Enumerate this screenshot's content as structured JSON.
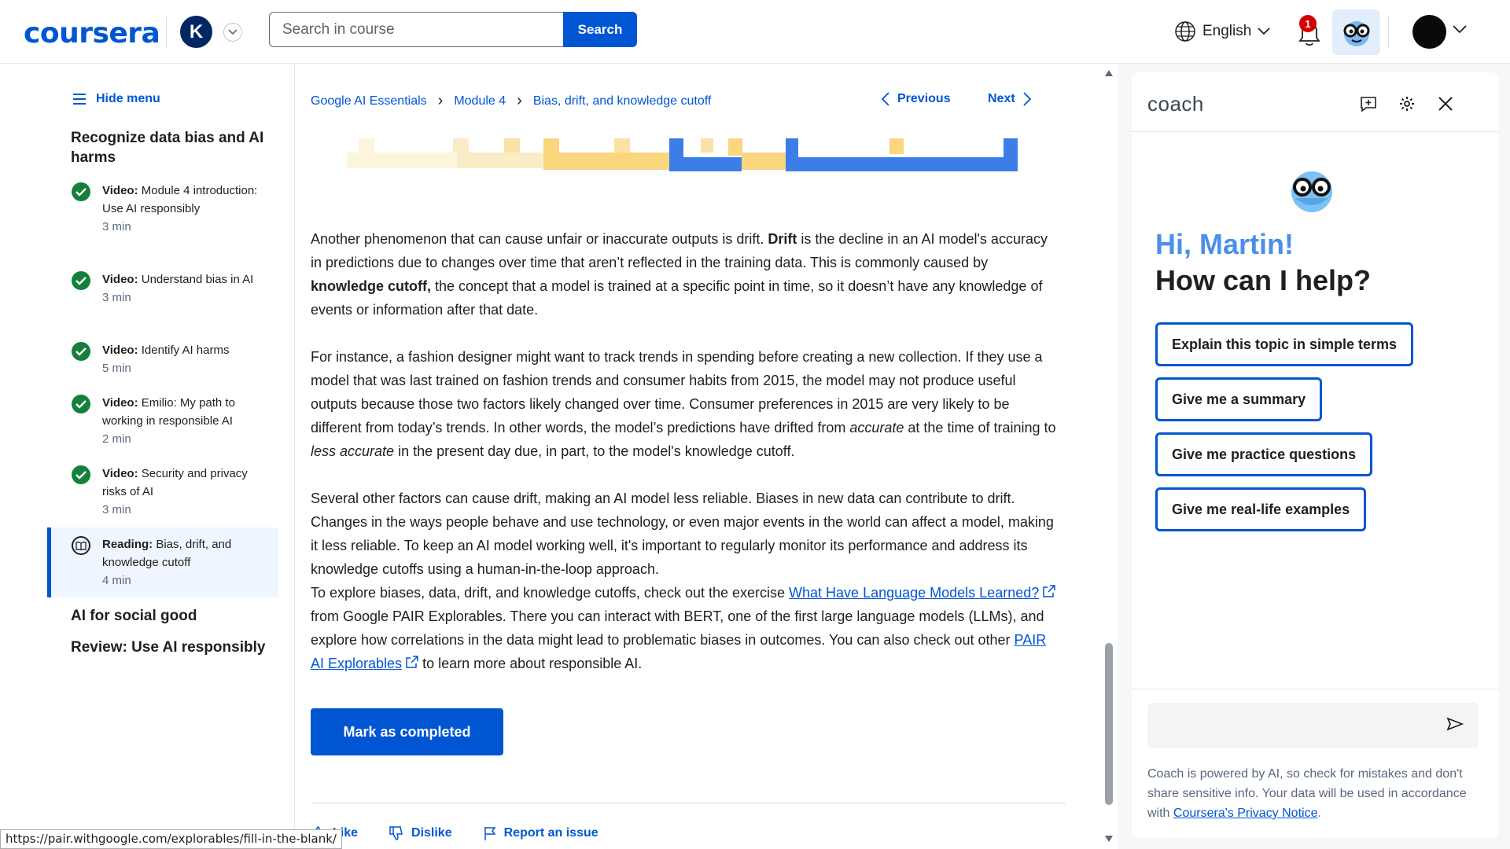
{
  "header": {
    "logo": "coursera",
    "user_initial": "K",
    "search_placeholder": "Search in course",
    "search_button": "Search",
    "language": "English",
    "notification_count": "1"
  },
  "sidebar": {
    "hide_menu": "Hide menu",
    "section_title": "Recognize data bias and AI harms",
    "items": [
      {
        "kind": "Video:",
        "title": " Module 4 introduction: Use AI responsibly",
        "duration": "3 min"
      },
      {
        "kind": "Video:",
        "title": " Understand bias in AI",
        "duration": "3 min"
      },
      {
        "kind": "Video:",
        "title": " Identify AI harms",
        "duration": "5 min"
      },
      {
        "kind": "Video:",
        "title": " Emilio: My path to working in responsible AI",
        "duration": "2 min"
      },
      {
        "kind": "Video:",
        "title": " Security and privacy risks of AI",
        "duration": "3 min"
      },
      {
        "kind": "Reading:",
        "title": " Bias, drift, and knowledge cutoff",
        "duration": "4 min"
      }
    ],
    "other_sections": [
      "AI for social good",
      "Review: Use AI responsibly"
    ]
  },
  "breadcrumb": [
    "Google AI Essentials",
    "Module 4",
    "Bias, drift, and knowledge cutoff"
  ],
  "nav": {
    "previous": "Previous",
    "next": "Next"
  },
  "content": {
    "p1": {
      "a": "Another phenomenon that can cause unfair or inaccurate outputs is drift. ",
      "b1": "Drift",
      "c": " is the decline in an AI model's accuracy in predictions due to changes over time that aren’t reflected in the training data. This is commonly caused by ",
      "b2": "knowledge cutoff,",
      "d": " the concept that a model is trained at a specific point in time, so it doesn’t have any knowledge of events or information after that date."
    },
    "p2": {
      "a": "For instance, a fashion designer might want to track trends in spending before creating a new collection. If they use a model that was last trained on fashion trends and consumer habits from 2015, the model may not produce useful outputs because those two factors likely changed over time. Consumer preferences in 2015 are very likely to be different from today’s trends. In other words, the model’s predictions have drifted from ",
      "i1": "accurate",
      "b": " at the time of training to ",
      "i2": "less accurate",
      "c": " in the present day due, in part, to the model's knowledge cutoff."
    },
    "p3": "Several other factors can cause drift, making an AI model less reliable. Biases in new data can contribute to drift. Changes in the ways people behave and use technology, or even major events in the world can affect a model, making it less reliable. To keep an AI model working well, it's important to regularly monitor its performance and address its knowledge cutoffs using a human-in-the-loop approach.",
    "p4": {
      "a": "To explore biases, data, drift, and knowledge cutoffs, check out the exercise ",
      "link1": "What Have Language Models Learned?",
      "b": " from Google PAIR Explorables. There you can interact with BERT, one of the first large language models (LLMs), and explore how correlations in the data might lead to problematic biases in outcomes. You can also check out other ",
      "link2": "PAIR AI Explorables",
      "c": " to learn more about responsible AI."
    },
    "mark_completed": "Mark as completed",
    "actions": {
      "like": "Like",
      "dislike": "Dislike",
      "report": "Report an issue"
    }
  },
  "coach": {
    "title": "coach",
    "greeting": "Hi, Martin!",
    "question": "How can I help?",
    "chips": [
      "Explain this topic in simple terms",
      "Give me a summary",
      "Give me practice questions",
      "Give me real-life examples"
    ],
    "input_placeholder": "",
    "disclaimer_text": "Coach is powered by AI, so check for mistakes and don't share sensitive info. Your data will be used in accordance with ",
    "disclaimer_link": "Coursera's Privacy Notice",
    "disclaimer_end": "."
  },
  "status_url": "https://pair.withgoogle.com/explorables/fill-in-the-blank/",
  "colors": {
    "brand": "#0056d2",
    "complete": "#157f3c",
    "coach_hi": "#4b90e8"
  }
}
